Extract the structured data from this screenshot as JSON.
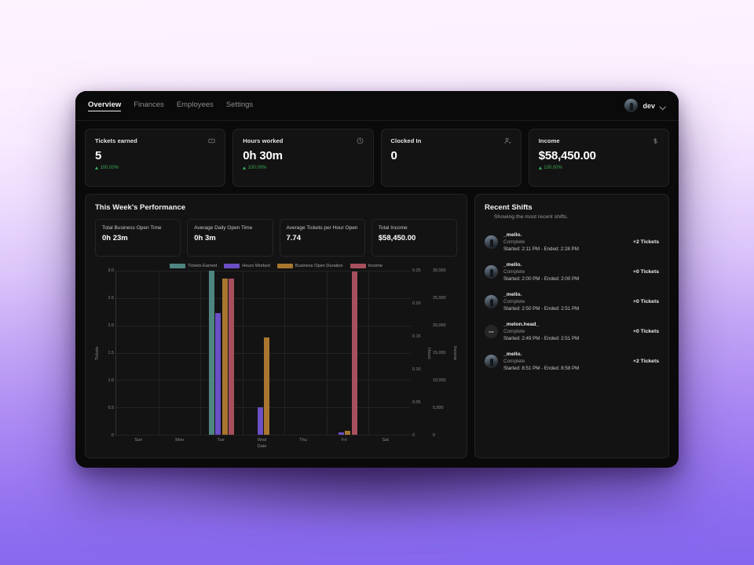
{
  "nav": {
    "items": [
      {
        "label": "Overview",
        "active": true
      },
      {
        "label": "Finances",
        "active": false
      },
      {
        "label": "Employees",
        "active": false
      },
      {
        "label": "Settings",
        "active": false
      }
    ],
    "user": "dev"
  },
  "stats": [
    {
      "title": "Tickets earned",
      "value": "5",
      "delta": "100.00%",
      "icon": "ticket-icon"
    },
    {
      "title": "Hours worked",
      "value": "0h 30m",
      "delta": "100.00%",
      "icon": "clock-icon"
    },
    {
      "title": "Clocked In",
      "value": "0",
      "delta": "",
      "icon": "user-check-icon"
    },
    {
      "title": "Income",
      "value": "$58,450.00",
      "delta": "100.00%",
      "icon": "dollar-icon"
    }
  ],
  "performance": {
    "title": "This Week's Performance",
    "metrics": [
      {
        "label": "Total Business Open Time",
        "value": "0h 23m"
      },
      {
        "label": "Average Daily Open Time",
        "value": "0h 3m"
      },
      {
        "label": "Average Tickets per Hour Open",
        "value": "7.74"
      },
      {
        "label": "Total Income",
        "value": "$58,450.00"
      }
    ]
  },
  "chart_data": {
    "type": "bar",
    "title": "",
    "xlabel": "Date",
    "categories": [
      "Sun",
      "Mon",
      "Tue",
      "Wed",
      "Thu",
      "Fri",
      "Sat"
    ],
    "grid": true,
    "legend_position": "top",
    "axes": [
      {
        "name": "Tickets",
        "side": "left",
        "ylim": [
          0,
          3.0
        ],
        "ticks": [
          "0",
          "0.5",
          "1.0",
          "1.5",
          "2.0",
          "2.5",
          "3.0"
        ]
      },
      {
        "name": "Hours",
        "side": "right",
        "ylim": [
          0,
          0.25
        ],
        "ticks": [
          "0",
          "0.05",
          "0.10",
          "0.15",
          "0.20",
          "0.25"
        ]
      },
      {
        "name": "Income",
        "side": "right",
        "ylim": [
          0,
          30000
        ],
        "ticks": [
          "0",
          "5,000",
          "10,000",
          "15,000",
          "20,000",
          "25,000",
          "30,000"
        ]
      }
    ],
    "series": [
      {
        "name": "Tickets Earned",
        "color": "#4f8581",
        "axis": "Tickets",
        "values": [
          0,
          0,
          3.0,
          0,
          0,
          0,
          0
        ]
      },
      {
        "name": "Hours Worked",
        "color": "#6b4fc4",
        "axis": "Hours",
        "values": [
          0,
          0,
          0.185,
          0.042,
          0,
          0.004,
          0
        ]
      },
      {
        "name": "Business Open Duration",
        "color": "#a9762f",
        "axis": "Hours",
        "values": [
          0,
          0,
          0.238,
          0.148,
          0,
          0.006,
          0
        ]
      },
      {
        "name": "Income",
        "color": "#a84f5e",
        "axis": "Income",
        "values": [
          0,
          0,
          28500,
          0,
          0,
          29800,
          0
        ]
      }
    ]
  },
  "shifts": {
    "title": "Recent Shifts",
    "subtitle": "Showing the most recent shifts.",
    "rows": [
      {
        "name": "_mello.",
        "status": "Complete",
        "time": "Started: 2:11 PM - Ended: 2:28 PM",
        "tickets": "+2 Tickets",
        "avatar": "photo"
      },
      {
        "name": "_mello.",
        "status": "Complete",
        "time": "Started: 2:00 PM - Ended: 2:00 PM",
        "tickets": "+0 Tickets",
        "avatar": "photo"
      },
      {
        "name": "_mello.",
        "status": "Complete",
        "time": "Started: 2:50 PM - Ended: 2:51 PM",
        "tickets": "+0 Tickets",
        "avatar": "photo"
      },
      {
        "name": "_melon.head_",
        "status": "Complete",
        "time": "Started: 2:49 PM - Ended: 2:51 PM",
        "tickets": "+0 Tickets",
        "avatar": "plain"
      },
      {
        "name": "_mello.",
        "status": "Complete",
        "time": "Started: 8:51 PM - Ended: 8:58 PM",
        "tickets": "+2 Tickets",
        "avatar": "photo"
      }
    ]
  }
}
